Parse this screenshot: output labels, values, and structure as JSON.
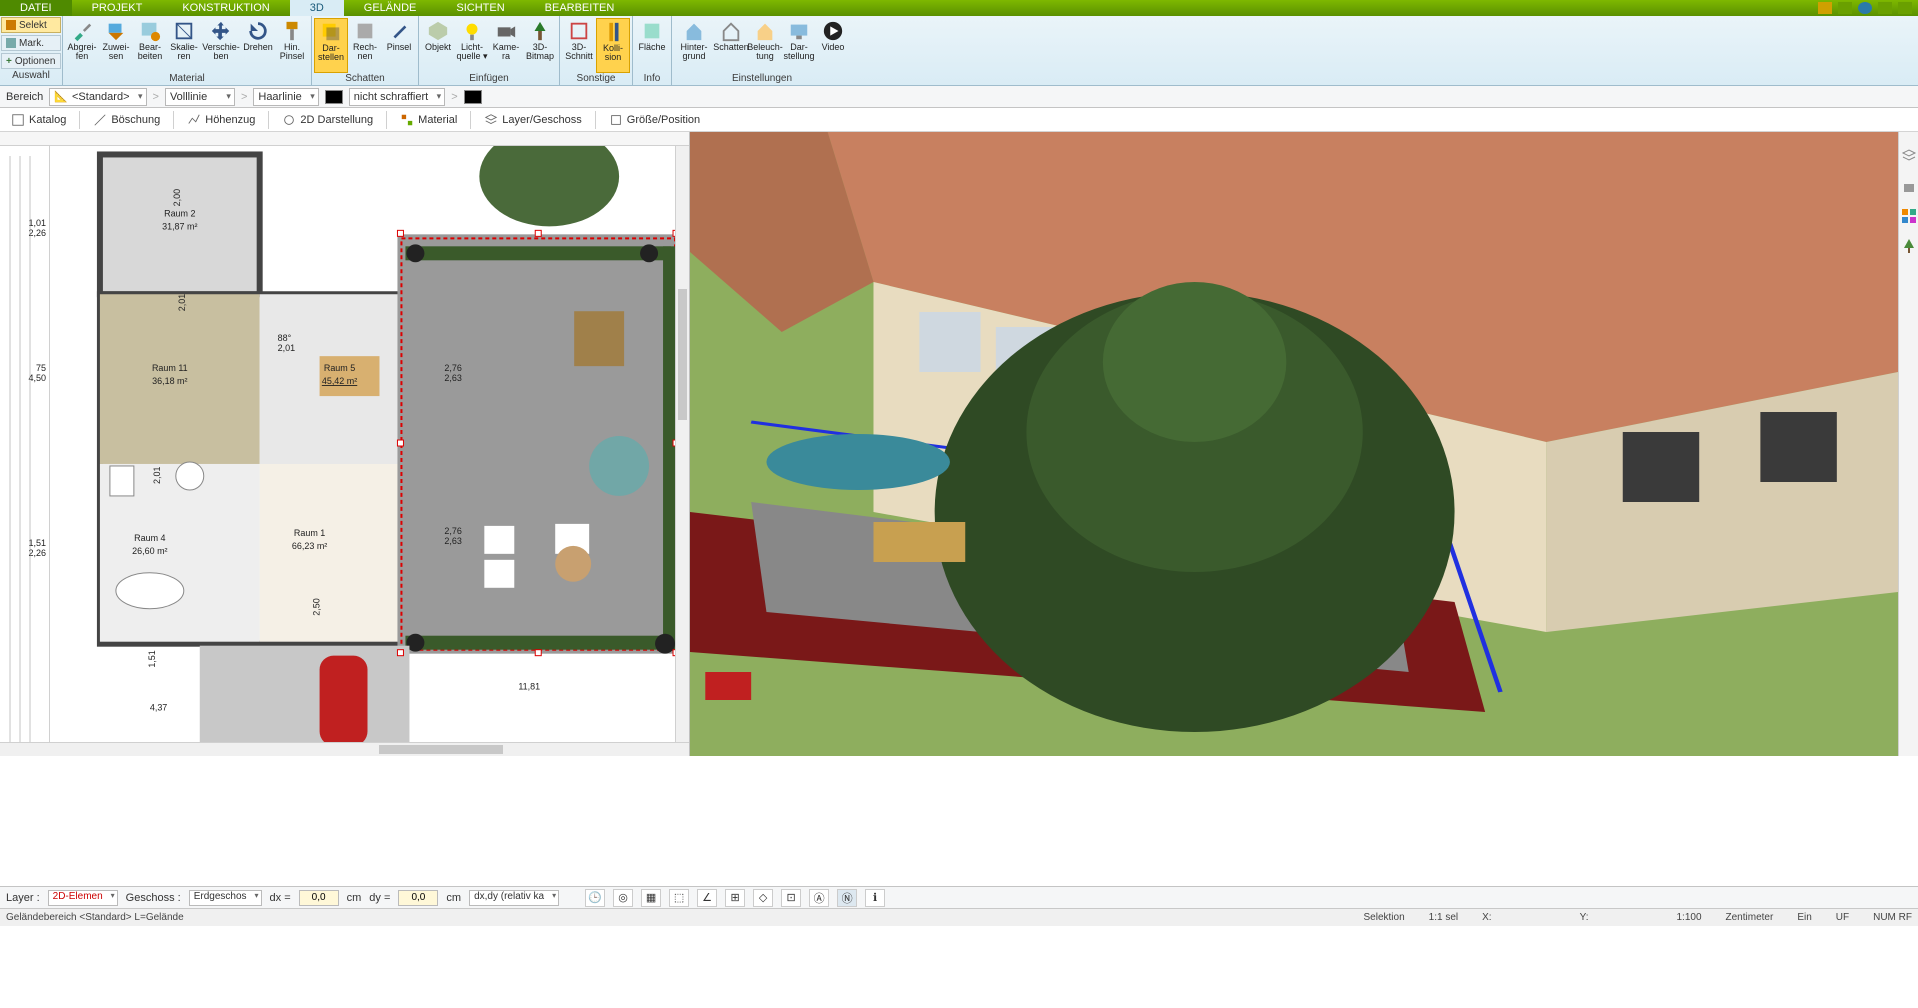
{
  "menu": {
    "tabs": [
      "DATEI",
      "PROJEKT",
      "KONSTRUKTION",
      "3D",
      "GELÄNDE",
      "SICHTEN",
      "BEARBEITEN"
    ],
    "active_index": 3
  },
  "ribbon_left": {
    "select": "Selekt",
    "mark": "Mark.",
    "options": "Optionen",
    "group": "Auswahl"
  },
  "ribbon": {
    "groups": [
      {
        "name": "Material",
        "tools": [
          "Abgrei-\nfen",
          "Zuwei-\nsen",
          "Bear-\nbeiten",
          "Skalie-\nren",
          "Verschie-\nben",
          "Drehen",
          "Hin.\nPinsel"
        ]
      },
      {
        "name": "Schatten",
        "tools": [
          "Dar-\nstellen",
          "Rech-\nnen",
          "Pinsel"
        ],
        "selected": 0
      },
      {
        "name": "Einfügen",
        "tools": [
          "Objekt",
          "Licht-\nquelle ▾",
          "Kame-\nra",
          "3D-\nBitmap"
        ]
      },
      {
        "name": "Sonstige",
        "tools": [
          "3D-\nSchnitt",
          "Kolli-\nsion"
        ],
        "selected": 1
      },
      {
        "name": "Info",
        "tools": [
          "Fläche"
        ]
      },
      {
        "name": "Einstellungen",
        "tools": [
          "Hinter-\ngrund",
          "Schatten",
          "Beleuch-\ntung",
          "Dar-\nstellung",
          "Video"
        ]
      }
    ]
  },
  "propbar": {
    "bereich_label": "Bereich",
    "bereich_value": "<Standard>",
    "line_style": "Volllinie",
    "line_weight": "Haarlinie",
    "hatch": "nicht schraffiert"
  },
  "toolbar2": {
    "items": [
      "Katalog",
      "Böschung",
      "Höhenzug",
      "2D Darstellung",
      "Material",
      "Layer/Geschoss",
      "Größe/Position"
    ]
  },
  "plan": {
    "rooms": [
      {
        "name": "Raum 2",
        "area": "31,87 m²"
      },
      {
        "name": "Raum 11",
        "area": "36,18 m²"
      },
      {
        "name": "Raum 5",
        "area": "45,42 m²"
      },
      {
        "name": "Raum 4",
        "area": "26,60 m²"
      },
      {
        "name": "Raum 1",
        "area": "66,23 m²"
      }
    ],
    "dims_left": [
      {
        "a": "1,01",
        "b": "2,26"
      },
      {
        "a": "75",
        "b": "4,50"
      },
      {
        "a": "1,51",
        "b": "2,26"
      }
    ],
    "dims_inline": [
      {
        "deg": "88°",
        "len": "2,01"
      },
      {
        "a": "2,76",
        "b": "2,63"
      },
      {
        "a": "2,76",
        "b": "2,63"
      },
      {
        "val": "2,50"
      },
      {
        "val": "2,01"
      },
      {
        "val": "2,00"
      },
      {
        "val": "2,01"
      },
      {
        "val": "1,51"
      },
      {
        "val": "4,37"
      },
      {
        "val": "11,81"
      }
    ]
  },
  "bottombar": {
    "layer_label": "Layer :",
    "layer_value": "2D-Elemen",
    "geschoss_label": "Geschoss :",
    "geschoss_value": "Erdgeschos",
    "dx_label": "dx =",
    "dx_value": "0,0",
    "dy_label": "dy =",
    "dy_value": "0,0",
    "unit": "cm",
    "mode": "dx,dy (relativ ka"
  },
  "statusbar": {
    "left": "Geländebereich <Standard> L=Gelände",
    "selektion": "Selektion",
    "ratio": "1:1 sel",
    "x_label": "X:",
    "y_label": "Y:",
    "scale": "1:100",
    "unit": "Zentimeter",
    "ein": "Ein",
    "uf": "UF",
    "num": "NUM RF"
  }
}
